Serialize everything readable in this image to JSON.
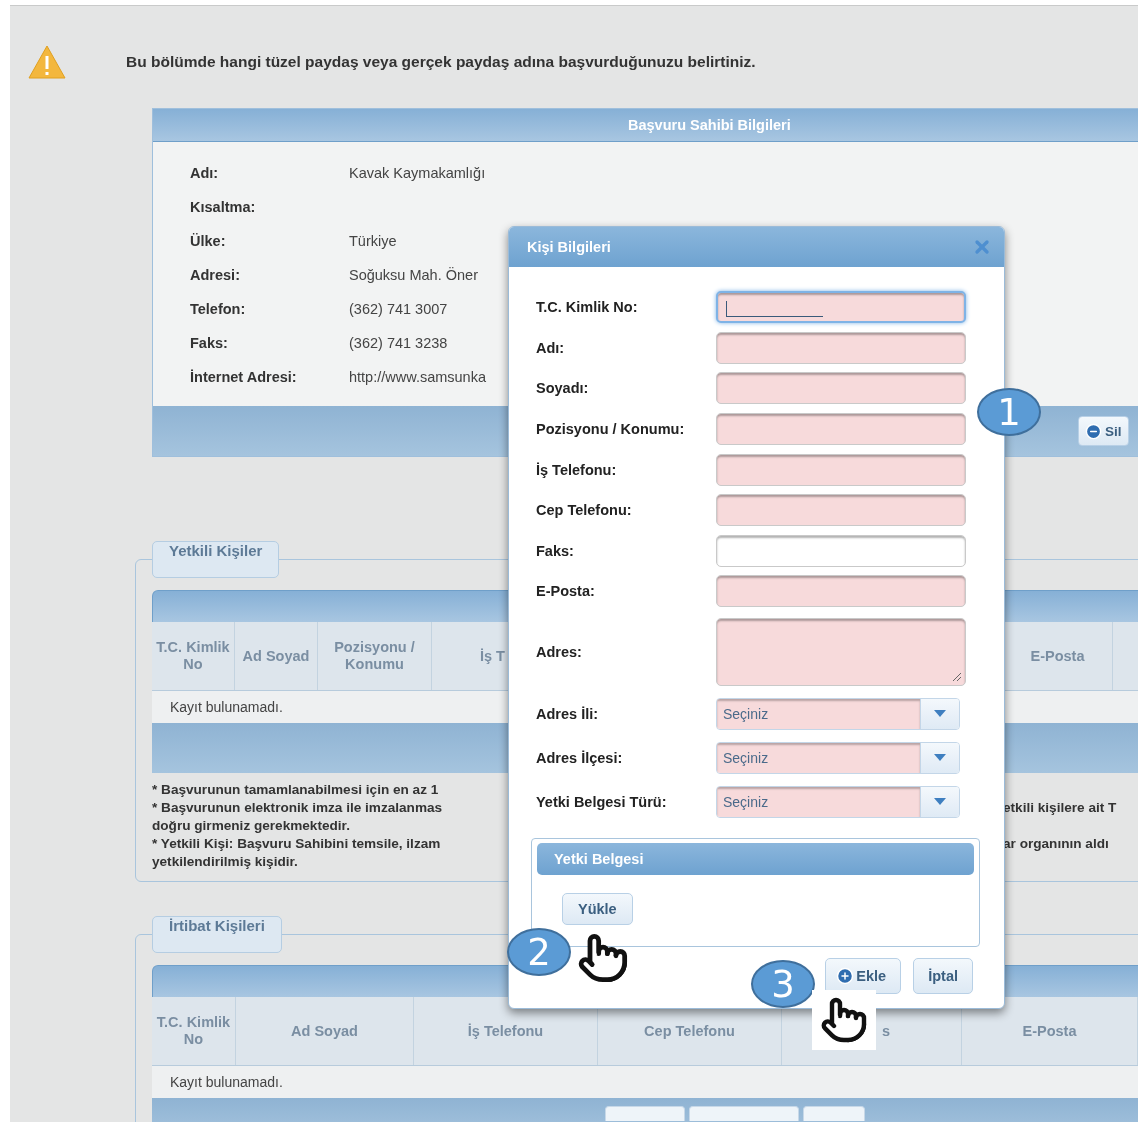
{
  "notice": "Bu bölümde hangi tüzel paydaş veya gerçek paydaş adına başvurduğunuzu belirtiniz.",
  "applicant_panel": {
    "title": "Başvuru Sahibi Bilgileri",
    "rows": [
      {
        "label": "Adı:",
        "value": "Kavak Kaymakamlığı"
      },
      {
        "label": "Kısaltma:"
      },
      {
        "label": "Ülke:",
        "value": "Türkiye"
      },
      {
        "label": "Adresi:",
        "value": "Soğuksu Mah. Öner"
      },
      {
        "label": "Telefon:",
        "value": "(362) 741 3007"
      },
      {
        "label": "Faks:",
        "value": "(362) 741 3238"
      },
      {
        "label": "İnternet Adresi:",
        "value": "http://www.samsunka"
      }
    ],
    "buttons": [
      "Sil"
    ]
  },
  "authorized_persons": {
    "legend": "Yetkili Kişiler",
    "columns": [
      "T.C. Kimlik No",
      "Ad Soyad",
      "Pozisyonu / Konumu",
      "İş T",
      "E-Posta"
    ],
    "empty_text": "Kayıt bulunamadı.",
    "notes": [
      {
        "left": "* Başvurunun tamamlanabilmesi için en az 1"
      },
      {
        "left": "* Başvurunun elektronik imza ile imzalanmas",
        "right": "etkili kişilere ait T"
      },
      {
        "left": "doğru girmeniz gerekmektedir."
      },
      {
        "left": "* Yetkili Kişi: Başvuru Sahibini temsile, ilzam",
        "right": "ar organının aldı"
      },
      {
        "left": "yetkilendirilmiş kişidir."
      }
    ]
  },
  "contact_persons": {
    "legend": "İrtibat Kişileri",
    "columns": [
      "T.C. Kimlik No",
      "Ad Soyad",
      "İş Telefonu",
      "Cep Telefonu",
      "s",
      "E-Posta"
    ],
    "empty_text": "Kayıt bulunamadı."
  },
  "dialog": {
    "title": "Kişi Bilgileri",
    "fields": [
      {
        "kind": "text",
        "label": "T.C. Kimlik No:",
        "required": true,
        "focused": true
      },
      {
        "kind": "text",
        "label": "Adı:",
        "required": true,
        "focused": false
      },
      {
        "kind": "text",
        "label": "Soyadı:",
        "required": true,
        "focused": false
      },
      {
        "kind": "text",
        "label": "Pozisyonu / Konumu:",
        "required": true,
        "focused": false
      },
      {
        "kind": "text",
        "label": "İş Telefonu:",
        "required": true,
        "focused": false
      },
      {
        "kind": "text",
        "label": "Cep Telefonu:",
        "required": true,
        "focused": false
      },
      {
        "kind": "text",
        "label": "Faks:",
        "required": false,
        "focused": false
      },
      {
        "kind": "text",
        "label": "E-Posta:",
        "required": true,
        "focused": false
      },
      {
        "kind": "textarea",
        "label": "Adres:",
        "required": true,
        "focused": false
      },
      {
        "kind": "select",
        "label": "Adres İli:",
        "value": "Seçiniz",
        "required": true
      },
      {
        "kind": "select",
        "label": "Adres İlçesi:",
        "value": "Seçiniz",
        "required": true
      },
      {
        "kind": "select",
        "label": "Yetki Belgesi Türü:",
        "value": "Seçiniz",
        "required": true
      }
    ],
    "document_section": {
      "title": "Yetki Belgesi",
      "button": "Yükle"
    },
    "buttons": [
      {
        "kind": "add",
        "label": "Ekle"
      },
      {
        "kind": "cancel",
        "label": "İptal"
      }
    ]
  },
  "callouts": [
    "1",
    "2",
    "3"
  ]
}
